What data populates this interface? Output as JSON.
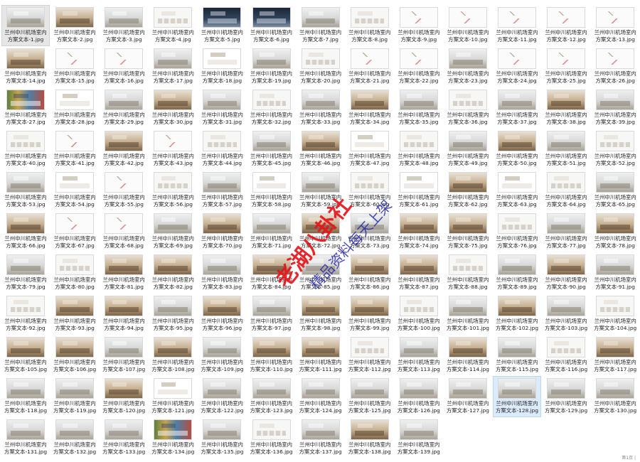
{
  "gallery": {
    "caption_prefix": "兰州中川机场室内\n方案文本-",
    "file_ext": ".jpg",
    "count": 139,
    "columns": 13,
    "selected_item": 1,
    "focused_item": 128
  },
  "watermark": {
    "line1": "老湖八卦社",
    "line2": "精品资料每天上架"
  },
  "statusbar": {
    "corner_text": "第1页 |"
  },
  "thumb_styles": [
    "doc",
    "plan",
    "render",
    "warm",
    "dark",
    "photo",
    "section"
  ]
}
